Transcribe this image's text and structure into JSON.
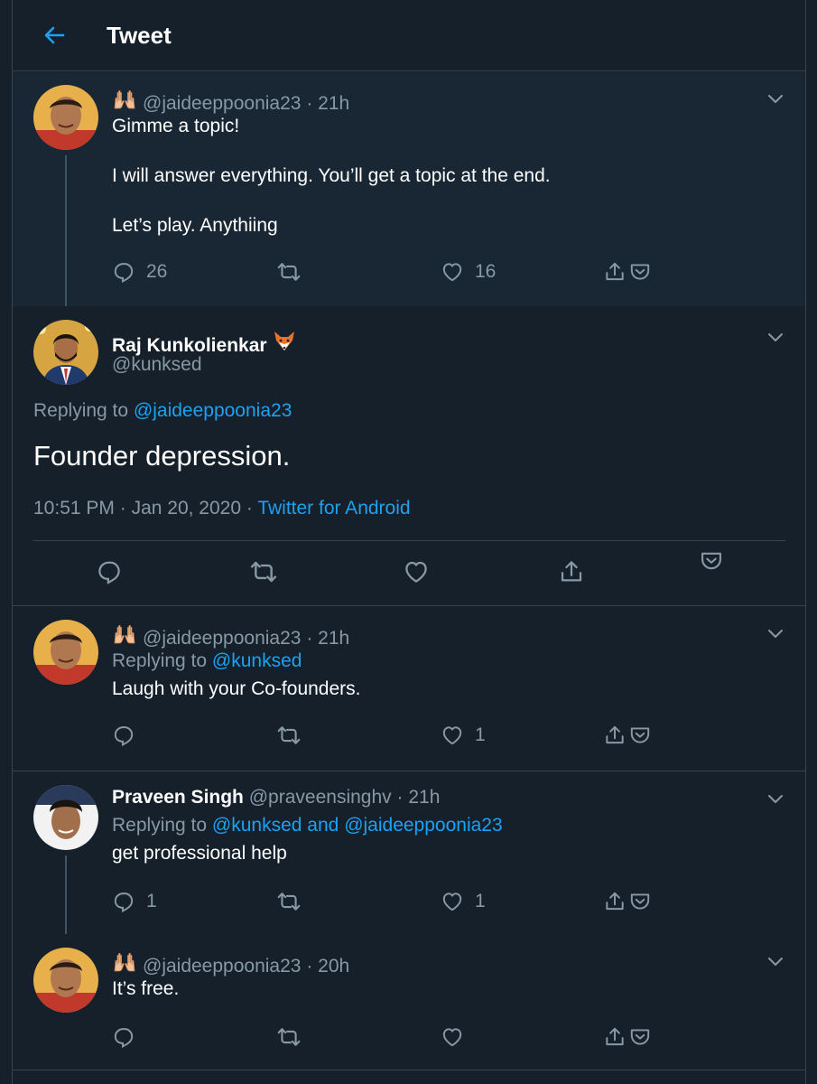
{
  "header": {
    "title": "Tweet",
    "back_icon": "back-arrow-icon"
  },
  "colors": {
    "background": "#15202b",
    "parent_background": "#192734",
    "accent": "#1da1f2",
    "muted": "#8899a6",
    "border": "#38444d"
  },
  "tweets": [
    {
      "handle": "@jaideeppoonia23",
      "time": "21h",
      "emoji": "🙌",
      "lines": [
        "Gimme a topic!",
        "I will answer everything. You’ll get a topic at the end.",
        "Let’s play. Anythiing"
      ],
      "replies": "26",
      "retweets": "",
      "likes": "16"
    },
    {
      "display_name": "Raj Kunkolienkar",
      "name_emoji": "🦊",
      "handle": "@kunksed",
      "replying_prefix": "Replying to",
      "replying_to": "@jaideeppoonia23",
      "text": "Founder depression.",
      "time": "10:51 PM",
      "date": "Jan 20, 2020",
      "source": "Twitter for Android"
    },
    {
      "handle": "@jaideeppoonia23",
      "time": "21h",
      "emoji": "🙌",
      "replying_prefix": "Replying to",
      "replying_to": "@kunksed",
      "text": "Laugh with your Co-founders.",
      "replies": "",
      "retweets": "",
      "likes": "1"
    },
    {
      "display_name": "Praveen Singh",
      "handle": "@praveensinghv",
      "time": "21h",
      "replying_prefix": "Replying to",
      "replying_to_a": "@kunksed",
      "replying_and": "and",
      "replying_to_b": "@jaideeppoonia23",
      "text": "get professional help",
      "replies": "1",
      "retweets": "",
      "likes": "1"
    },
    {
      "handle": "@jaideeppoonia23",
      "time": "20h",
      "emoji": "🙌",
      "text": "It’s free.",
      "replies": "",
      "retweets": "",
      "likes": ""
    }
  ],
  "separator": "·"
}
